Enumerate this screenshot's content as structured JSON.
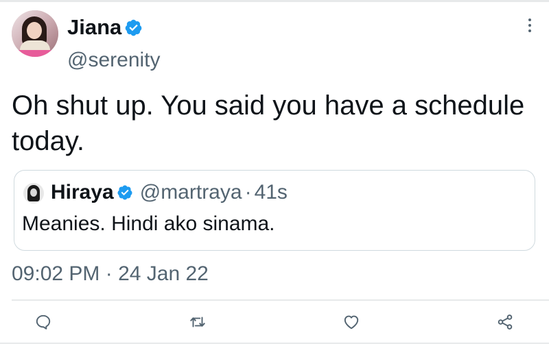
{
  "tweet": {
    "author_name": "Jiana",
    "author_handle": "@serenity",
    "text": "Oh shut up. You said you have a schedule today.",
    "timestamp": "09:02 PM · 24 Jan 22"
  },
  "quoted_tweet": {
    "author_name": "Hiraya",
    "author_handle": "@martraya",
    "separator": "·",
    "age": "41s",
    "text": "Meanies. Hindi ako sinama."
  },
  "actions": [
    {
      "icon": "reply-icon"
    },
    {
      "icon": "retweet-icon"
    },
    {
      "icon": "like-icon"
    },
    {
      "icon": "share-icon"
    }
  ],
  "colors": {
    "verified": "#1d9bf0",
    "secondary_text": "#536471",
    "primary_text": "#0f1419",
    "border": "#cfd9de"
  }
}
